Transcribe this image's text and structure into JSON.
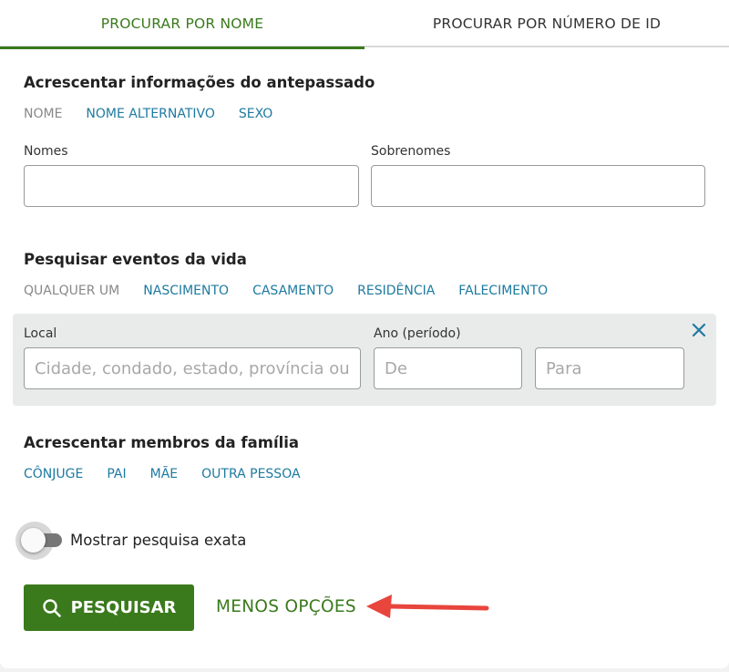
{
  "tabs": {
    "by_name": "PROCURAR POR NOME",
    "by_id": "PROCURAR POR NÚMERO DE ID"
  },
  "ancestor": {
    "title": "Acrescentar informações do antepassado",
    "links": [
      "NOME",
      "NOME ALTERNATIVO",
      "SEXO"
    ],
    "given_names_label": "Nomes",
    "surnames_label": "Sobrenomes",
    "given_names_value": "",
    "surnames_value": ""
  },
  "events": {
    "title": "Pesquisar eventos da vida",
    "links": [
      "QUALQUER UM",
      "NASCIMENTO",
      "CASAMENTO",
      "RESIDÊNCIA",
      "FALECIMENTO"
    ],
    "place_label": "Local",
    "place_placeholder": "Cidade, condado, estado, província ou país",
    "year_label": "Ano (período)",
    "from_placeholder": "De",
    "to_placeholder": "Para"
  },
  "family": {
    "title": "Acrescentar membros da família",
    "links": [
      "CÔNJUGE",
      "PAI",
      "MÃE",
      "OUTRA PESSOA"
    ]
  },
  "exact": {
    "label": "Mostrar pesquisa exata",
    "enabled": false
  },
  "actions": {
    "search_label": "PESQUISAR",
    "less_options_label": "MENOS OPÇÕES"
  },
  "colors": {
    "brand_green": "#3a7a1c",
    "link_blue": "#1d7aa0",
    "annotation_red": "#e8453c"
  },
  "icons": {
    "search": "magnifier-icon",
    "close": "close-icon",
    "annotation": "red-arrow-icon"
  }
}
